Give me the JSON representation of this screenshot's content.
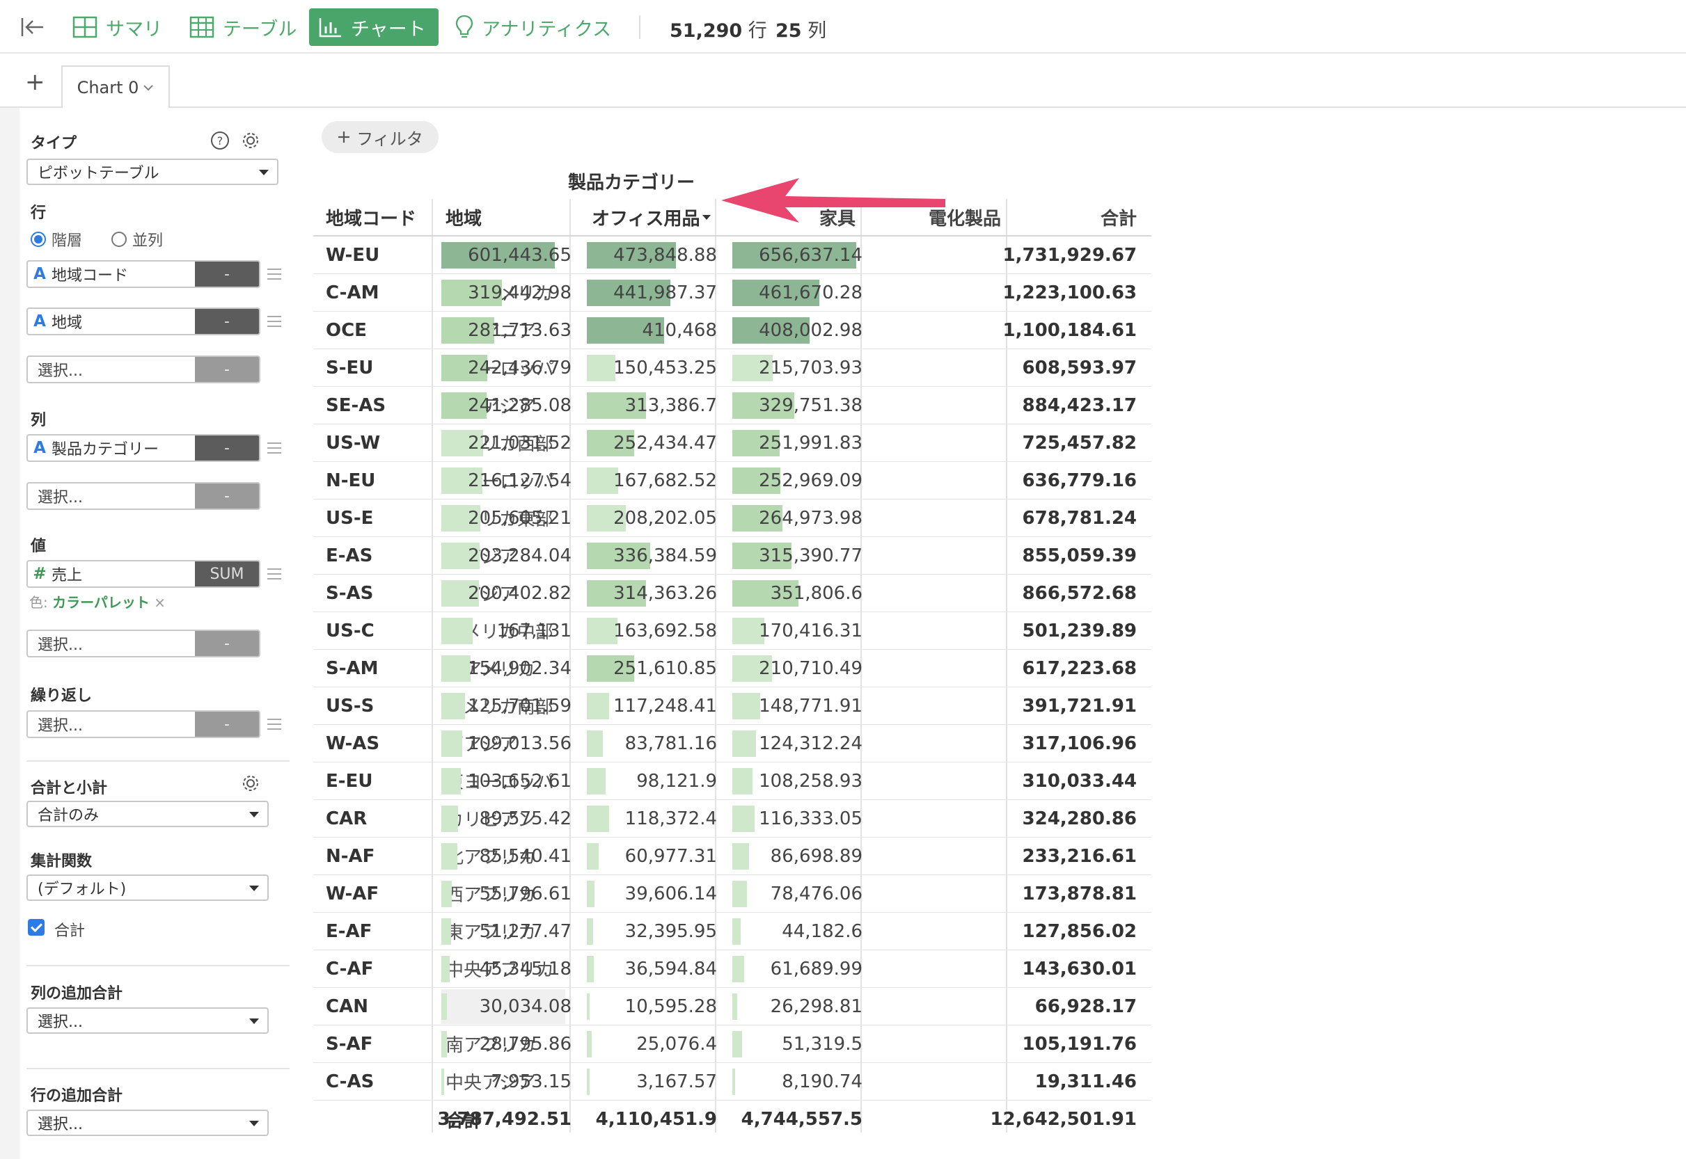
{
  "toolbar": {
    "tabs": [
      {
        "label": "サマリ",
        "icon": "summary-grid-icon",
        "active": false
      },
      {
        "label": "テーブル",
        "icon": "table-icon",
        "active": false
      },
      {
        "label": "チャート",
        "icon": "chart-icon",
        "active": true
      },
      {
        "label": "アナリティクス",
        "icon": "lightbulb-icon",
        "active": false
      }
    ],
    "rows_count": "51,290",
    "rows_unit": "行",
    "cols_count": "25",
    "cols_unit": "列"
  },
  "chart_tabs": {
    "add": "+",
    "current": "Chart 0"
  },
  "panel": {
    "type_label": "タイプ",
    "type_value": "ピボットテーブル",
    "rows_label": "行",
    "radio_hierarchy": "階層",
    "radio_parallel": "並列",
    "row_fields": [
      {
        "type": "A",
        "name": "地域コード",
        "agg": "-"
      },
      {
        "type": "A",
        "name": "地域",
        "agg": "-"
      }
    ],
    "select_placeholder": "選択...",
    "dash": "-",
    "cols_label": "列",
    "col_field": {
      "type": "A",
      "name": "製品カテゴリー",
      "agg": "-"
    },
    "values_label": "値",
    "value_field": {
      "type": "#",
      "name": "売上",
      "agg": "SUM"
    },
    "color_prefix": "色: ",
    "color_link": "カラーパレット",
    "color_remove": "×",
    "repeat_label": "繰り返し",
    "totals_label": "合計と小計",
    "totals_value": "合計のみ",
    "aggfunc_label": "集計関数",
    "aggfunc_value": "(デフォルト)",
    "total_check_label": "合計",
    "col_extra_label": "列の追加合計",
    "row_extra_label": "行の追加合計"
  },
  "main": {
    "filter_label": "フィルタ",
    "column_group_title": "製品カテゴリー"
  },
  "colors": {
    "accent": "#4aa56a",
    "bar_light": "#cfe8cc",
    "bar_mid": "#b5d8b1",
    "bar_dark": "#8cb694",
    "arrow": "#e8456f"
  },
  "pivot": {
    "headers": [
      "地域コード",
      "地域",
      "オフィス用品",
      "家具",
      "電化製品",
      "合計"
    ],
    "sorted_column_icon": "sort-down-icon",
    "rows": [
      {
        "code": "W-EU",
        "region": "西ヨーロッパ",
        "values": [
          "601,443.65",
          "473,848.88",
          "656,637.14"
        ],
        "total": "1,731,929.67"
      },
      {
        "code": "C-AM",
        "region": "中央アメリカ",
        "values": [
          "319,442.98",
          "441,987.37",
          "461,670.28"
        ],
        "total": "1,223,100.63"
      },
      {
        "code": "OCE",
        "region": "オセアニア",
        "values": [
          "281,713.63",
          "410,468",
          "408,002.98"
        ],
        "total": "1,100,184.61"
      },
      {
        "code": "S-EU",
        "region": "南ヨーロッパ",
        "values": [
          "242,436.79",
          "150,453.25",
          "215,703.93"
        ],
        "total": "608,593.97"
      },
      {
        "code": "SE-AS",
        "region": "東南アジア",
        "values": [
          "241,285.08",
          "313,386.7",
          "329,751.38"
        ],
        "total": "884,423.17"
      },
      {
        "code": "US-W",
        "region": "アメリカ西部",
        "values": [
          "221,031.52",
          "252,434.47",
          "251,991.83"
        ],
        "total": "725,457.82"
      },
      {
        "code": "N-EU",
        "region": "北ヨーロッパ",
        "values": [
          "216,127.54",
          "167,682.52",
          "252,969.09"
        ],
        "total": "636,779.16"
      },
      {
        "code": "US-E",
        "region": "アメリカ東部",
        "values": [
          "205,605.21",
          "208,202.05",
          "264,973.98"
        ],
        "total": "678,781.24"
      },
      {
        "code": "E-AS",
        "region": "東アジア",
        "values": [
          "203,284.04",
          "336,384.59",
          "315,390.77"
        ],
        "total": "855,059.39"
      },
      {
        "code": "S-AS",
        "region": "南アジア",
        "values": [
          "200,402.82",
          "314,363.26",
          "351,806.6"
        ],
        "total": "866,572.68"
      },
      {
        "code": "US-C",
        "region": "アメリカ中部",
        "values": [
          "167,131",
          "163,692.58",
          "170,416.31"
        ],
        "total": "501,239.89"
      },
      {
        "code": "S-AM",
        "region": "南アメリカ",
        "values": [
          "154,902.34",
          "251,610.85",
          "210,710.49"
        ],
        "total": "617,223.68"
      },
      {
        "code": "US-S",
        "region": "アメリカ南部",
        "values": [
          "125,701.59",
          "117,248.41",
          "148,771.91"
        ],
        "total": "391,721.91"
      },
      {
        "code": "W-AS",
        "region": "西アジア",
        "values": [
          "109,013.56",
          "83,781.16",
          "124,312.24"
        ],
        "total": "317,106.96"
      },
      {
        "code": "E-EU",
        "region": "東ヨーロッパ",
        "values": [
          "103,652.61",
          "98,121.9",
          "108,258.93"
        ],
        "total": "310,033.44"
      },
      {
        "code": "CAR",
        "region": "カリビアン",
        "values": [
          "89,575.42",
          "118,372.4",
          "116,333.05"
        ],
        "total": "324,280.86"
      },
      {
        "code": "N-AF",
        "region": "北アフリカ",
        "values": [
          "85,540.41",
          "60,977.31",
          "86,698.89"
        ],
        "total": "233,216.61"
      },
      {
        "code": "W-AF",
        "region": "西アフリカ",
        "values": [
          "55,796.61",
          "39,606.14",
          "78,476.06"
        ],
        "total": "173,878.81"
      },
      {
        "code": "E-AF",
        "region": "東アフリカ",
        "values": [
          "51,277.47",
          "32,395.95",
          "44,182.6"
        ],
        "total": "127,856.02"
      },
      {
        "code": "C-AF",
        "region": "中央アフリカ",
        "values": [
          "45,345.18",
          "36,594.84",
          "61,689.99"
        ],
        "total": "143,630.01"
      },
      {
        "code": "CAN",
        "region": "カナダ",
        "values": [
          "30,034.08",
          "10,595.28",
          "26,298.81"
        ],
        "total": "66,928.17"
      },
      {
        "code": "S-AF",
        "region": "南アフリカ",
        "values": [
          "28,795.86",
          "25,076.4",
          "51,319.5"
        ],
        "total": "105,191.76"
      },
      {
        "code": "C-AS",
        "region": "中央アジア",
        "values": [
          "7,953.15",
          "3,167.57",
          "8,190.74"
        ],
        "total": "19,311.46"
      }
    ],
    "total_row": {
      "label": "合計",
      "values": [
        "3,787,492.51",
        "4,110,451.9",
        "4,744,557.5"
      ],
      "total": "12,642,501.91"
    },
    "bar_scale_max": 656637.14,
    "hovered_cell": "CAN-オフィス用品"
  }
}
